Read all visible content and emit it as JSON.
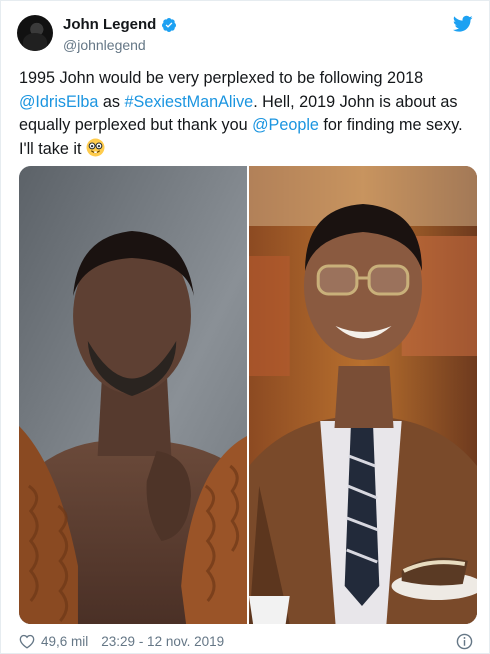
{
  "user": {
    "display_name": "John Legend",
    "handle": "@johnlegend"
  },
  "tweet": {
    "part1": "1995 John would be very perplexed to be following 2018 ",
    "mention1": "@IdrisElba",
    "part2": " as ",
    "hashtag": "#SexiestManAlive",
    "part3": ". Hell, 2019 John is about as equally perplexed but thank you ",
    "mention2": "@People",
    "part4": " for finding me sexy. I'll take it ",
    "emoji": "nerd-face"
  },
  "footer": {
    "likes": "49,6 mil",
    "timestamp": "23:29 - 12 nov. 2019"
  },
  "colors": {
    "link": "#1b95e0",
    "twitter_blue": "#1da1f2",
    "secondary_text": "#657786"
  }
}
